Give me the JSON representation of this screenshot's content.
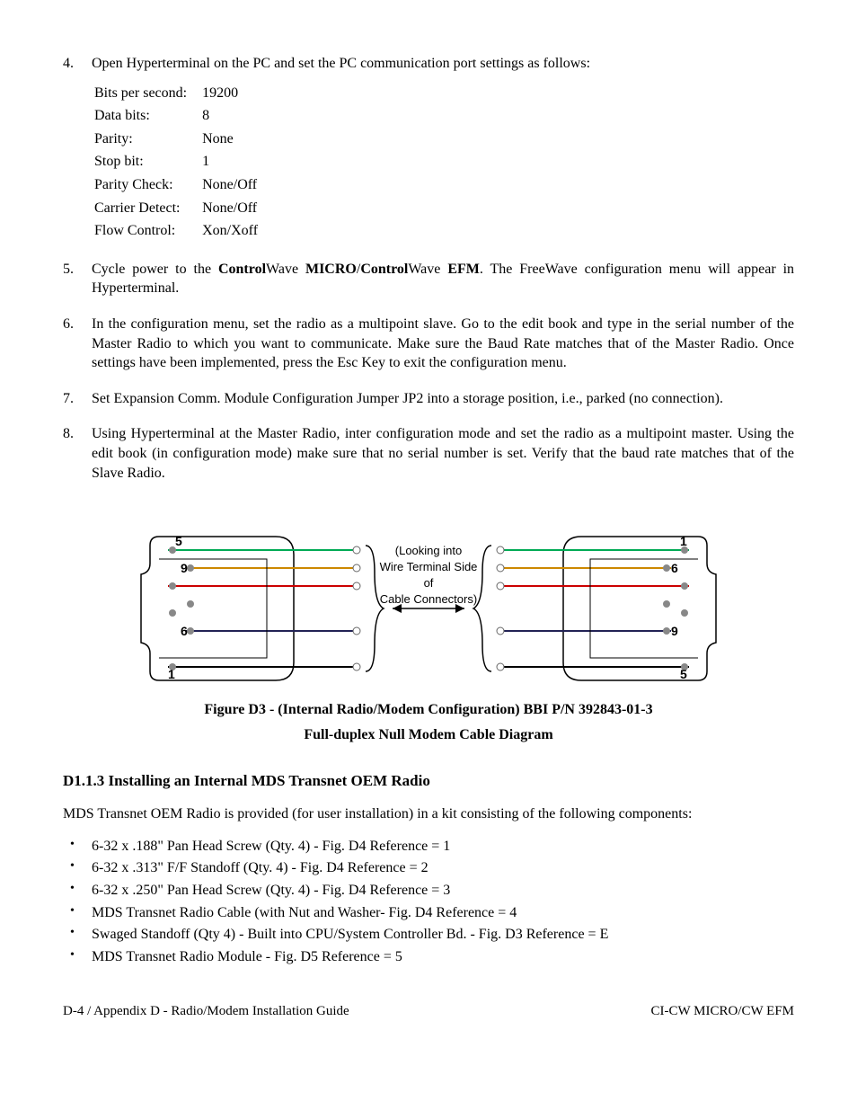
{
  "steps": {
    "s4": {
      "num": "4.",
      "text": "Open Hyperterminal on the PC and set the PC communication port settings as follows:"
    },
    "settings": [
      {
        "label": "Bits per second:",
        "value": "19200"
      },
      {
        "label": "Data bits:",
        "value": "8"
      },
      {
        "label": "Parity:",
        "value": "None"
      },
      {
        "label": "Stop bit:",
        "value": "1"
      },
      {
        "label": "Parity Check:",
        "value": "None/Off"
      },
      {
        "label": "Carrier Detect:",
        "value": "None/Off"
      },
      {
        "label": "Flow Control:",
        "value": "Xon/Xoff"
      }
    ],
    "s5": {
      "num": "5.",
      "pre": "Cycle power to the ",
      "b1": "Control",
      "m1": "Wave ",
      "b2": "MICRO",
      "m2": "/",
      "b3": "Control",
      "m3": "Wave ",
      "b4": "EFM",
      "post": ". The FreeWave configuration menu will appear in Hyperterminal."
    },
    "s6": {
      "num": "6.",
      "text": "In the configuration menu, set the radio as a multipoint slave. Go to the edit book and type in the serial number of the Master Radio to which you want to communicate. Make sure the Baud Rate matches that of the Master Radio. Once settings have been implemented, press the Esc Key to exit the configuration menu."
    },
    "s7": {
      "num": "7.",
      "text": "Set Expansion Comm. Module Configuration Jumper JP2 into a storage position, i.e., parked (no connection)."
    },
    "s8": {
      "num": "8.",
      "text": "Using Hyperterminal at the Master Radio, inter configuration mode and set the radio as a multipoint master. Using the edit book (in configuration mode) make sure that no serial number is set. Verify that the baud rate matches that of the Slave Radio."
    }
  },
  "figure": {
    "center_lines": [
      "(Looking into",
      "Wire Terminal Side",
      "of",
      "Cable Connectors)"
    ],
    "caption_line1": "Figure D3 - (Internal Radio/Modem Configuration) BBI P/N 392843-01-3",
    "caption_line2": "Full-duplex Null Modem Cable Diagram",
    "left_labels": {
      "top": "5",
      "tm": "9",
      "bm": "6",
      "bot": "1"
    },
    "right_labels": {
      "top": "1",
      "tm": "6",
      "bm": "9",
      "bot": "5"
    }
  },
  "section": {
    "heading": "D1.1.3  Installing an Internal MDS Transnet OEM Radio",
    "intro": "MDS Transnet OEM Radio is provided (for user installation) in a kit consisting of the following components:",
    "bullets": [
      "6-32 x .188\" Pan Head Screw (Qty. 4) - Fig. D4 Reference = 1",
      "6-32 x .313\" F/F Standoff  (Qty. 4) - Fig. D4 Reference = 2",
      "6-32 x .250\" Pan Head Screw (Qty. 4) - Fig. D4 Reference = 3",
      "MDS Transnet Radio Cable (with Nut and Washer- Fig. D4 Reference = 4",
      "Swaged Standoff (Qty 4) - Built into CPU/System Controller Bd. - Fig. D3 Reference = E",
      "MDS Transnet Radio Module - Fig. D5 Reference = 5"
    ]
  },
  "footer": {
    "left": "D-4 / Appendix D - Radio/Modem Installation Guide",
    "right": "CI-CW MICRO/CW EFM"
  }
}
